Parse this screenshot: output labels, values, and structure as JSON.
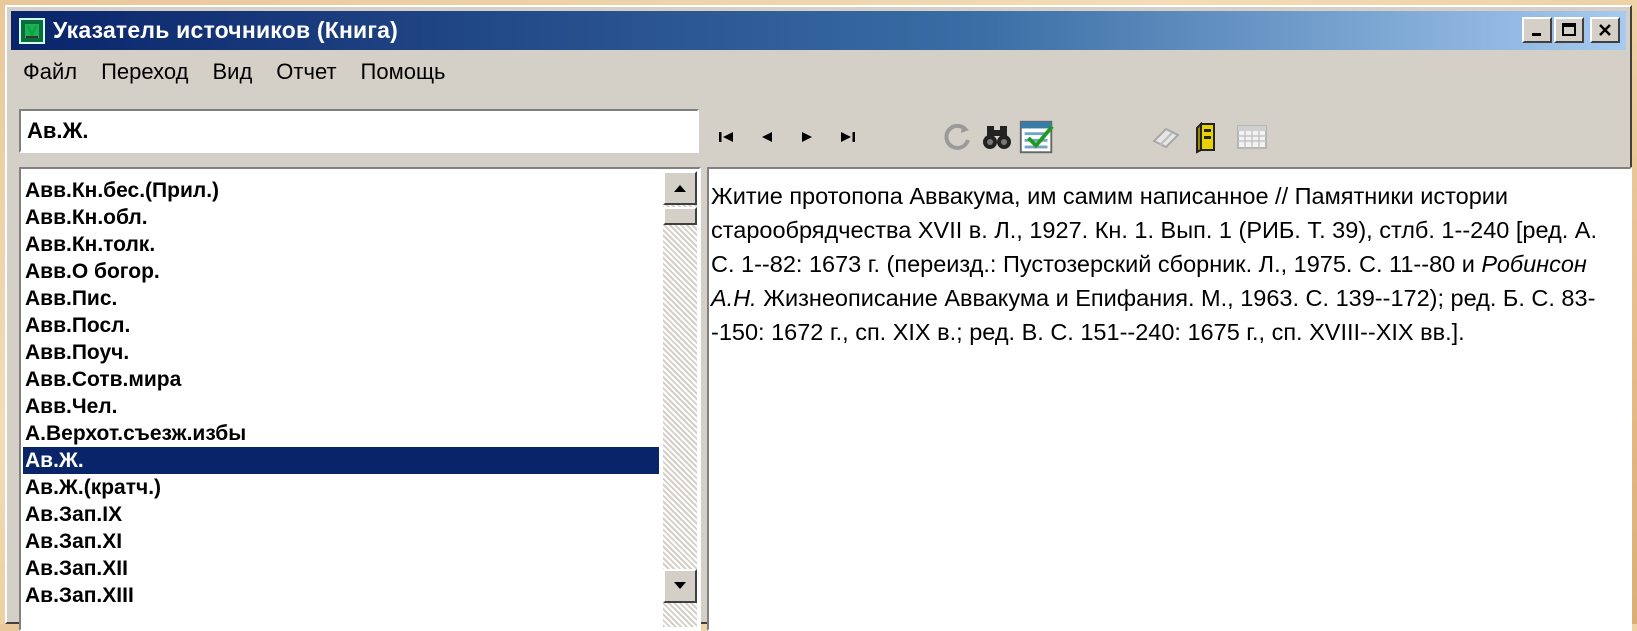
{
  "window": {
    "title": "Указатель источников (Книга)",
    "icons": [
      "app-icon",
      "minimize-icon",
      "maximize-icon",
      "close-icon"
    ]
  },
  "menu": [
    "Файл",
    "Переход",
    "Вид",
    "Отчет",
    "Помощь"
  ],
  "search": {
    "value": "Ав.Ж."
  },
  "toolbar": {
    "tools": [
      "first-record-icon",
      "previous-record-icon",
      "next-record-icon",
      "last-record-icon",
      "refresh-icon",
      "binoculars-icon",
      "checklist-icon",
      "eraser-icon",
      "book-icon",
      "calendar-grid-icon"
    ]
  },
  "list": {
    "items": [
      "Авв.Кн.бес.(Прил.)",
      "Авв.Кн.обл.",
      "Авв.Кн.толк.",
      "Авв.О богор.",
      "Авв.Пис.",
      "Авв.Посл.",
      "Авв.Поуч.",
      "Авв.Сотв.мира",
      "Авв.Чел.",
      "А.Верхот.съезж.избы",
      "Ав.Ж.",
      "Ав.Ж.(кратч.)",
      "Ав.Зап.IX",
      "Ав.Зап.XI",
      "Ав.Зап.XII",
      "Ав.Зап.XIII"
    ],
    "selected_index": 10
  },
  "detail": {
    "part1": "Житие протопопа Аввакума, им самим написанное // Памятники истории старообрядчества XVII в. Л., 1927. Кн. 1. Вып. 1 (РИБ. Т. 39), стлб. 1--240 [ред. А. С. 1--82: 1673 г. (переизд.: Пустозерский сборник. Л., 1975. С. 11--80 и ",
    "italic": "Робинсон А.Н.",
    "part2": " Жизнеописание Аввакума и Епифания. М., 1963. С. 139--172); ред. Б. С. 83--150: 1672 г., сп. XIX в.; ред. В. С. 151--240: 1675 г., сп. XVIII--XIX вв.]."
  },
  "colors": {
    "title_bar_start": "#0a246a",
    "title_bar_end": "#a6caf0",
    "selection": "#0a246a",
    "window_face": "#d4d0c8"
  }
}
